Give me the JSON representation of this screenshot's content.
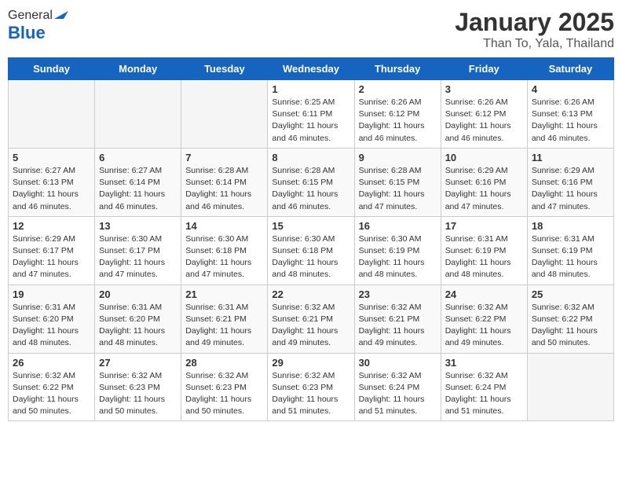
{
  "logo": {
    "general": "General",
    "blue": "Blue"
  },
  "header": {
    "title": "January 2025",
    "subtitle": "Than To, Yala, Thailand"
  },
  "weekdays": [
    "Sunday",
    "Monday",
    "Tuesday",
    "Wednesday",
    "Thursday",
    "Friday",
    "Saturday"
  ],
  "weeks": [
    [
      {
        "day": "",
        "info": ""
      },
      {
        "day": "",
        "info": ""
      },
      {
        "day": "",
        "info": ""
      },
      {
        "day": "1",
        "info": "Sunrise: 6:25 AM\nSunset: 6:11 PM\nDaylight: 11 hours\nand 46 minutes."
      },
      {
        "day": "2",
        "info": "Sunrise: 6:26 AM\nSunset: 6:12 PM\nDaylight: 11 hours\nand 46 minutes."
      },
      {
        "day": "3",
        "info": "Sunrise: 6:26 AM\nSunset: 6:12 PM\nDaylight: 11 hours\nand 46 minutes."
      },
      {
        "day": "4",
        "info": "Sunrise: 6:26 AM\nSunset: 6:13 PM\nDaylight: 11 hours\nand 46 minutes."
      }
    ],
    [
      {
        "day": "5",
        "info": "Sunrise: 6:27 AM\nSunset: 6:13 PM\nDaylight: 11 hours\nand 46 minutes."
      },
      {
        "day": "6",
        "info": "Sunrise: 6:27 AM\nSunset: 6:14 PM\nDaylight: 11 hours\nand 46 minutes."
      },
      {
        "day": "7",
        "info": "Sunrise: 6:28 AM\nSunset: 6:14 PM\nDaylight: 11 hours\nand 46 minutes."
      },
      {
        "day": "8",
        "info": "Sunrise: 6:28 AM\nSunset: 6:15 PM\nDaylight: 11 hours\nand 46 minutes."
      },
      {
        "day": "9",
        "info": "Sunrise: 6:28 AM\nSunset: 6:15 PM\nDaylight: 11 hours\nand 47 minutes."
      },
      {
        "day": "10",
        "info": "Sunrise: 6:29 AM\nSunset: 6:16 PM\nDaylight: 11 hours\nand 47 minutes."
      },
      {
        "day": "11",
        "info": "Sunrise: 6:29 AM\nSunset: 6:16 PM\nDaylight: 11 hours\nand 47 minutes."
      }
    ],
    [
      {
        "day": "12",
        "info": "Sunrise: 6:29 AM\nSunset: 6:17 PM\nDaylight: 11 hours\nand 47 minutes."
      },
      {
        "day": "13",
        "info": "Sunrise: 6:30 AM\nSunset: 6:17 PM\nDaylight: 11 hours\nand 47 minutes."
      },
      {
        "day": "14",
        "info": "Sunrise: 6:30 AM\nSunset: 6:18 PM\nDaylight: 11 hours\nand 47 minutes."
      },
      {
        "day": "15",
        "info": "Sunrise: 6:30 AM\nSunset: 6:18 PM\nDaylight: 11 hours\nand 48 minutes."
      },
      {
        "day": "16",
        "info": "Sunrise: 6:30 AM\nSunset: 6:19 PM\nDaylight: 11 hours\nand 48 minutes."
      },
      {
        "day": "17",
        "info": "Sunrise: 6:31 AM\nSunset: 6:19 PM\nDaylight: 11 hours\nand 48 minutes."
      },
      {
        "day": "18",
        "info": "Sunrise: 6:31 AM\nSunset: 6:19 PM\nDaylight: 11 hours\nand 48 minutes."
      }
    ],
    [
      {
        "day": "19",
        "info": "Sunrise: 6:31 AM\nSunset: 6:20 PM\nDaylight: 11 hours\nand 48 minutes."
      },
      {
        "day": "20",
        "info": "Sunrise: 6:31 AM\nSunset: 6:20 PM\nDaylight: 11 hours\nand 48 minutes."
      },
      {
        "day": "21",
        "info": "Sunrise: 6:31 AM\nSunset: 6:21 PM\nDaylight: 11 hours\nand 49 minutes."
      },
      {
        "day": "22",
        "info": "Sunrise: 6:32 AM\nSunset: 6:21 PM\nDaylight: 11 hours\nand 49 minutes."
      },
      {
        "day": "23",
        "info": "Sunrise: 6:32 AM\nSunset: 6:21 PM\nDaylight: 11 hours\nand 49 minutes."
      },
      {
        "day": "24",
        "info": "Sunrise: 6:32 AM\nSunset: 6:22 PM\nDaylight: 11 hours\nand 49 minutes."
      },
      {
        "day": "25",
        "info": "Sunrise: 6:32 AM\nSunset: 6:22 PM\nDaylight: 11 hours\nand 50 minutes."
      }
    ],
    [
      {
        "day": "26",
        "info": "Sunrise: 6:32 AM\nSunset: 6:22 PM\nDaylight: 11 hours\nand 50 minutes."
      },
      {
        "day": "27",
        "info": "Sunrise: 6:32 AM\nSunset: 6:23 PM\nDaylight: 11 hours\nand 50 minutes."
      },
      {
        "day": "28",
        "info": "Sunrise: 6:32 AM\nSunset: 6:23 PM\nDaylight: 11 hours\nand 50 minutes."
      },
      {
        "day": "29",
        "info": "Sunrise: 6:32 AM\nSunset: 6:23 PM\nDaylight: 11 hours\nand 51 minutes."
      },
      {
        "day": "30",
        "info": "Sunrise: 6:32 AM\nSunset: 6:24 PM\nDaylight: 11 hours\nand 51 minutes."
      },
      {
        "day": "31",
        "info": "Sunrise: 6:32 AM\nSunset: 6:24 PM\nDaylight: 11 hours\nand 51 minutes."
      },
      {
        "day": "",
        "info": ""
      }
    ]
  ]
}
